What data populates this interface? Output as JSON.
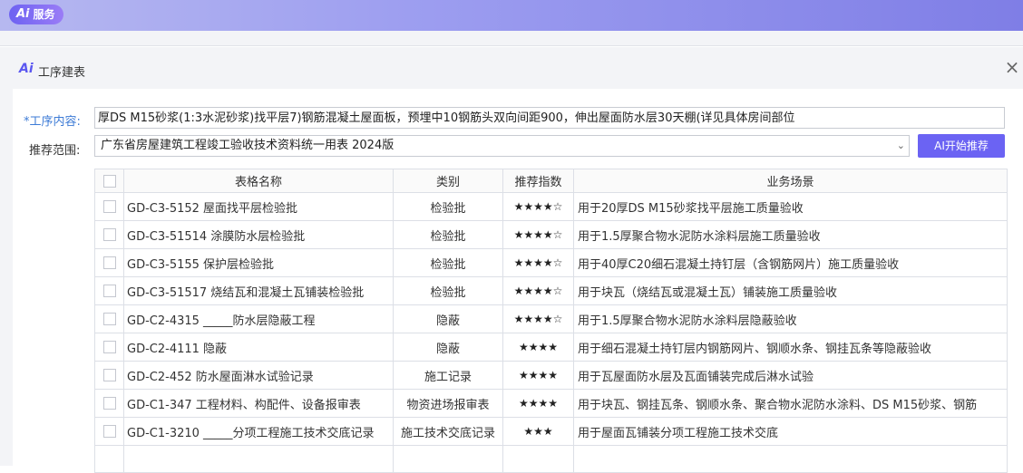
{
  "topbar": {
    "badge_logo": "Ai",
    "badge_label": "服务"
  },
  "dialog": {
    "title": "工序建表",
    "icon": "Ai",
    "close": "×"
  },
  "form": {
    "content_label": "*工序内容:",
    "content_value": "厚DS M15砂浆(1:3水泥砂浆)找平层7)钢筋混凝土屋面板，预埋中10钢筋头双向间距900，伸出屋面防水层30天棚(详见具体房间部位",
    "scope_label": "推荐范围:",
    "scope_value": "广东省房屋建筑工程竣工验收技术资料统一用表 2024版",
    "ai_button": "AI开始推荐"
  },
  "table": {
    "headers": [
      "表格名称",
      "类别",
      "推荐指数",
      "业务场景"
    ],
    "rows": [
      {
        "name": "GD-C3-5152 屋面找平层检验批",
        "type": "检验批",
        "stars": "★★★★☆",
        "scene": "用于20厚DS M15砂浆找平层施工质量验收"
      },
      {
        "name": "GD-C3-51514 涂膜防水层检验批",
        "type": "检验批",
        "stars": "★★★★☆",
        "scene": "用于1.5厚聚合物水泥防水涂料层施工质量验收"
      },
      {
        "name": "GD-C3-5155 保护层检验批",
        "type": "检验批",
        "stars": "★★★★☆",
        "scene": "用于40厚C20细石混凝土持钉层（含钢筋网片）施工质量验收"
      },
      {
        "name": "GD-C3-51517 烧结瓦和混凝土瓦铺装检验批",
        "type": "检验批",
        "stars": "★★★★☆",
        "scene": "用于块瓦（烧结瓦或混凝土瓦）铺装施工质量验收"
      },
      {
        "name": "GD-C2-4315 _____防水层隐蔽工程",
        "type": "隐蔽",
        "stars": "★★★★☆",
        "scene": "用于1.5厚聚合物水泥防水涂料层隐蔽验收"
      },
      {
        "name": "GD-C2-4111 隐蔽",
        "type": "隐蔽",
        "stars": "★★★★",
        "scene": "用于细石混凝土持钉层内钢筋网片、钢顺水条、钢挂瓦条等隐蔽验收"
      },
      {
        "name": "GD-C2-452 防水屋面淋水试验记录",
        "type": "施工记录",
        "stars": "★★★★",
        "scene": "用于瓦屋面防水层及瓦面铺装完成后淋水试验"
      },
      {
        "name": "GD-C1-347 工程材料、构配件、设备报审表",
        "type": "物资进场报审表",
        "stars": "★★★★",
        "scene": "用于块瓦、钢挂瓦条、钢顺水条、聚合物水泥防水涂料、DS M15砂浆、钢筋"
      },
      {
        "name": "GD-C1-3210 _____分项工程施工技术交底记录",
        "type": "施工技术交底记录",
        "stars": "★★★",
        "scene": "用于屋面瓦铺装分项工程施工技术交底"
      }
    ]
  }
}
